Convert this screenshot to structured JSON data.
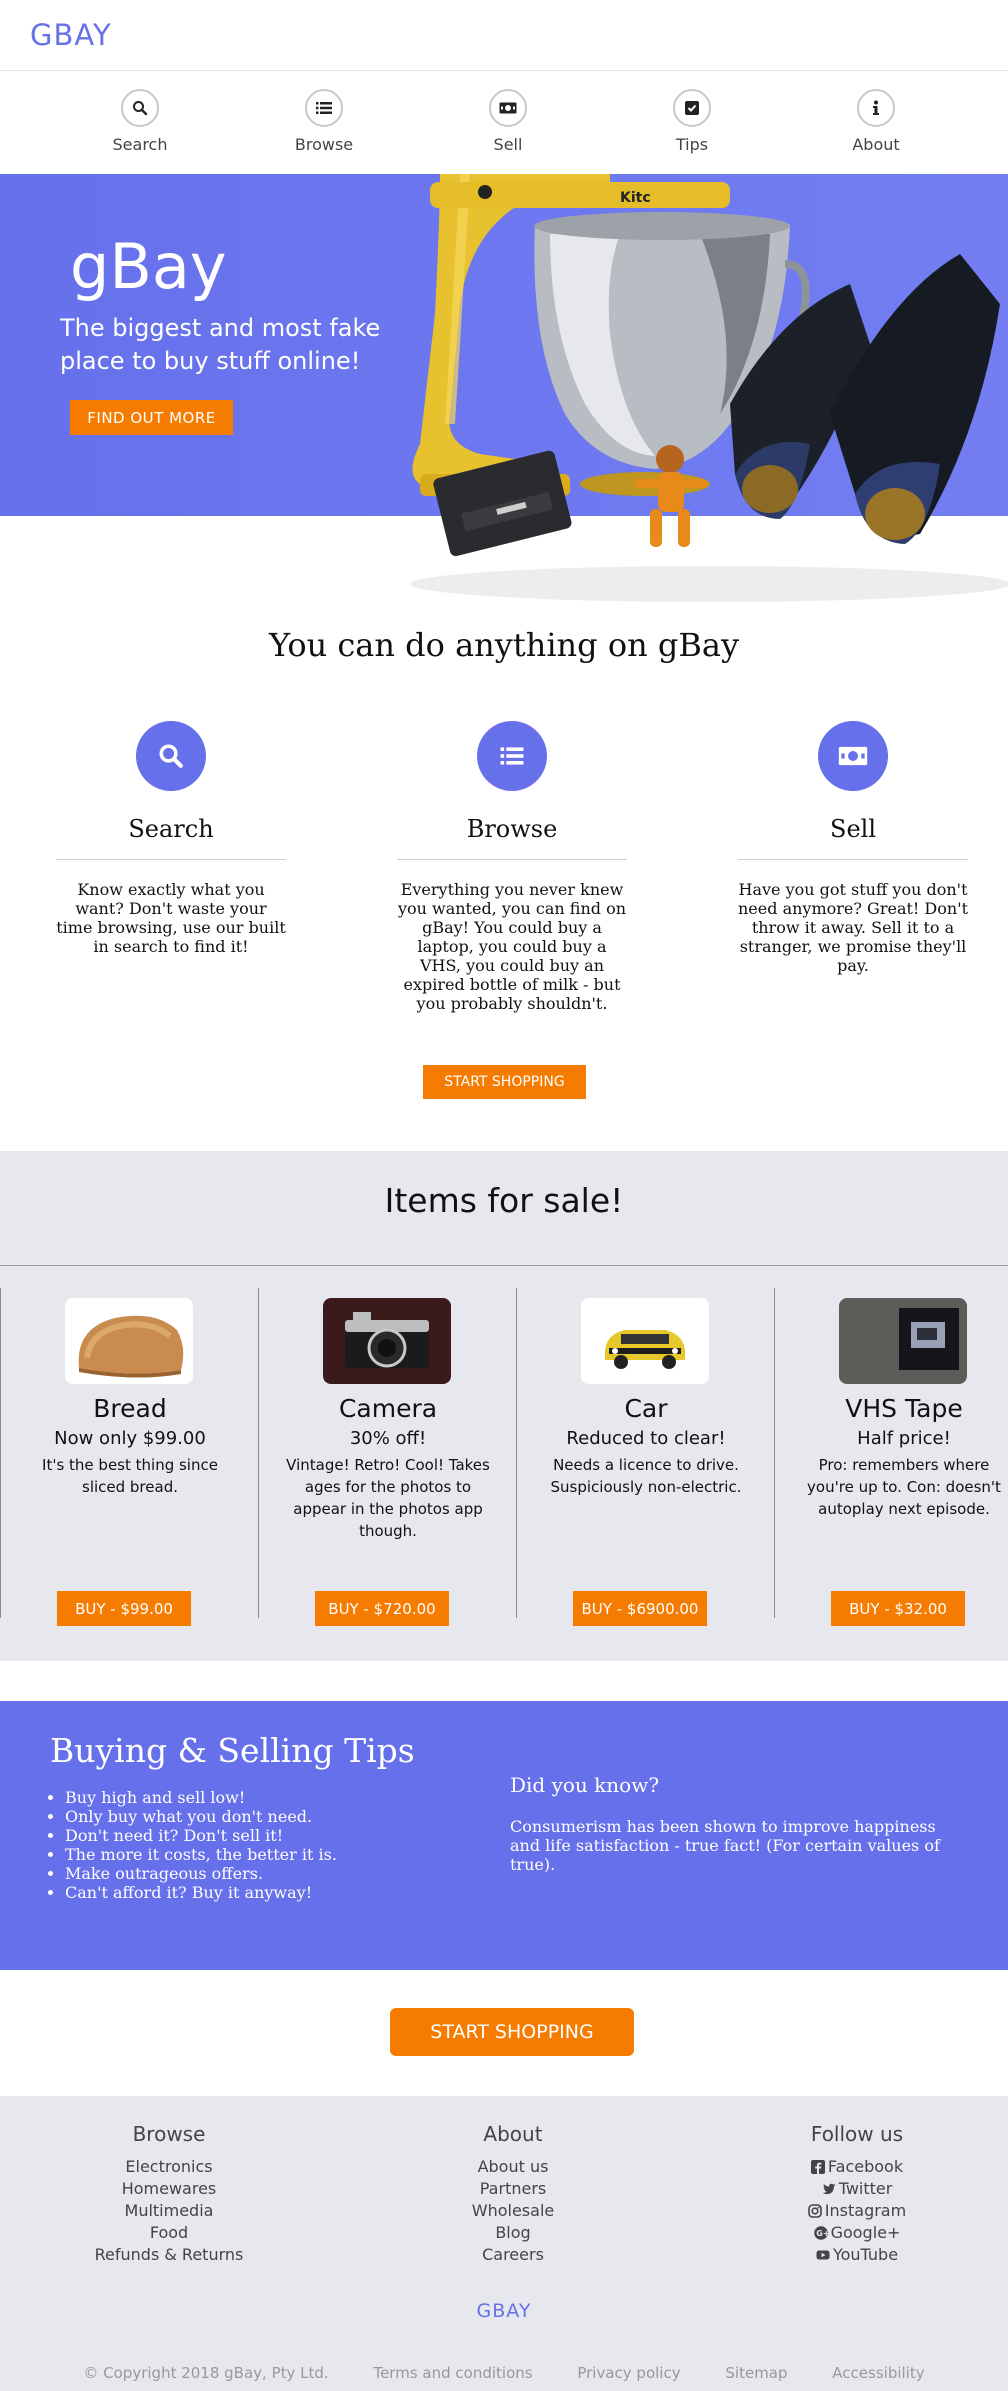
{
  "header": {
    "logo": "GBAY"
  },
  "nav": {
    "items": [
      {
        "label": "Search",
        "icon": "search-icon"
      },
      {
        "label": "Browse",
        "icon": "list-icon"
      },
      {
        "label": "Sell",
        "icon": "money-icon"
      },
      {
        "label": "Tips",
        "icon": "check-square-icon"
      },
      {
        "label": "About",
        "icon": "info-icon"
      }
    ]
  },
  "hero": {
    "title": "gBay",
    "subtitle": "The biggest and most fake place to buy stuff online!",
    "button": "FIND OUT MORE"
  },
  "features": {
    "title": "You can do anything on gBay",
    "items": [
      {
        "name": "Search",
        "icon": "search-icon",
        "text": "Know exactly what you want? Don't waste your time browsing, use our built in search to find it!"
      },
      {
        "name": "Browse",
        "icon": "list-icon",
        "text": "Everything you never knew you wanted, you can find on gBay! You could buy a laptop, you could buy a VHS, you could buy an expired bottle of milk - but you probably shouldn't."
      },
      {
        "name": "Sell",
        "icon": "money-icon",
        "text": "Have you got stuff you don't need anymore? Great! Don't throw it away. Sell it to a stranger, we promise they'll pay."
      }
    ],
    "button": "START SHOPPING"
  },
  "items_section": {
    "title": "Items for sale!",
    "items": [
      {
        "name": "Bread",
        "price": "Now only $99.00",
        "desc": "It's the best thing since sliced bread.",
        "button": "BUY - $99.00"
      },
      {
        "name": "Camera",
        "price": "30% off!",
        "desc": "Vintage! Retro! Cool! Takes ages for the photos to appear in the photos app though.",
        "button": "BUY - $720.00"
      },
      {
        "name": "Car",
        "price": "Reduced to clear!",
        "desc": "Needs a licence to drive. Suspiciously non-electric.",
        "button": "BUY - $6900.00"
      },
      {
        "name": "VHS Tape",
        "price": "Half price!",
        "desc": "Pro: remembers where you're up to. Con: doesn't autoplay next episode.",
        "button": "BUY - $32.00"
      }
    ]
  },
  "tips": {
    "title": "Buying & Selling Tips",
    "list": [
      "Buy high and sell low!",
      "Only buy what you don't need.",
      "Don't need it? Don't sell it!",
      "The more it costs, the better it is.",
      "Make outrageous offers.",
      "Can't afford it? Buy it anyway!"
    ],
    "dyk_title": "Did you know?",
    "dyk_text": "Consumerism has been shown to improve happiness and life satisfaction - true fact! (For certain values of true)."
  },
  "cta": {
    "button": "START SHOPPING"
  },
  "footer": {
    "browse": {
      "title": "Browse",
      "links": [
        "Electronics",
        "Homewares",
        "Multimedia",
        "Food",
        "Refunds & Returns"
      ]
    },
    "about": {
      "title": "About",
      "links": [
        "About us",
        "Partners",
        "Wholesale",
        "Blog",
        "Careers"
      ]
    },
    "follow": {
      "title": "Follow us",
      "links": [
        {
          "label": "Facebook",
          "icon": "facebook-icon"
        },
        {
          "label": "Twitter",
          "icon": "twitter-icon"
        },
        {
          "label": "Instagram",
          "icon": "instagram-icon"
        },
        {
          "label": "Google+",
          "icon": "google-plus-icon"
        },
        {
          "label": "YouTube",
          "icon": "youtube-icon"
        }
      ]
    },
    "logo": "GBAY",
    "copyright": "© Copyright 2018 gBay, Pty Ltd.",
    "bottom_links": [
      "Terms and conditions",
      "Privacy policy",
      "Sitemap",
      "Accessibility"
    ]
  },
  "colors": {
    "brand": "#6670ea",
    "accent": "#f57c00",
    "section_bg": "#e7e8ee"
  }
}
